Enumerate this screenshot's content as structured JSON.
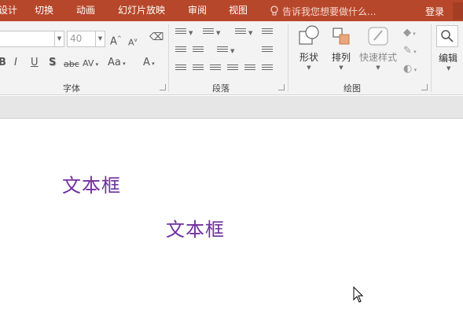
{
  "tabs": [
    "设计",
    "切换",
    "动画",
    "幻灯片放映",
    "审阅",
    "视图"
  ],
  "tell_me": {
    "placeholder": "告诉我您想要做什么..."
  },
  "account": {
    "login_label": "登录"
  },
  "ribbon": {
    "font_group": {
      "label": "字体",
      "font_name": "",
      "font_size": "40",
      "increase_font": "A",
      "decrease_font": "A",
      "bold": "B",
      "italic": "I",
      "underline": "U",
      "shadow": "S",
      "strikethrough": "abc",
      "char_spacing": "AV",
      "change_case": "Aa",
      "font_color": "A"
    },
    "paragraph_group": {
      "label": "段落"
    },
    "drawing_group": {
      "label": "绘图",
      "shapes_label": "形状",
      "arrange_label": "排列",
      "quick_styles_label": "快速样式"
    },
    "editing_group": {
      "label": "编辑"
    }
  },
  "slide": {
    "textbox_1": "文本框",
    "textbox_2": "文本框"
  },
  "colors": {
    "tab_bar": "#b7472a",
    "ribbon_bg": "#f3f3f3",
    "text_accent": "#7030a0"
  }
}
